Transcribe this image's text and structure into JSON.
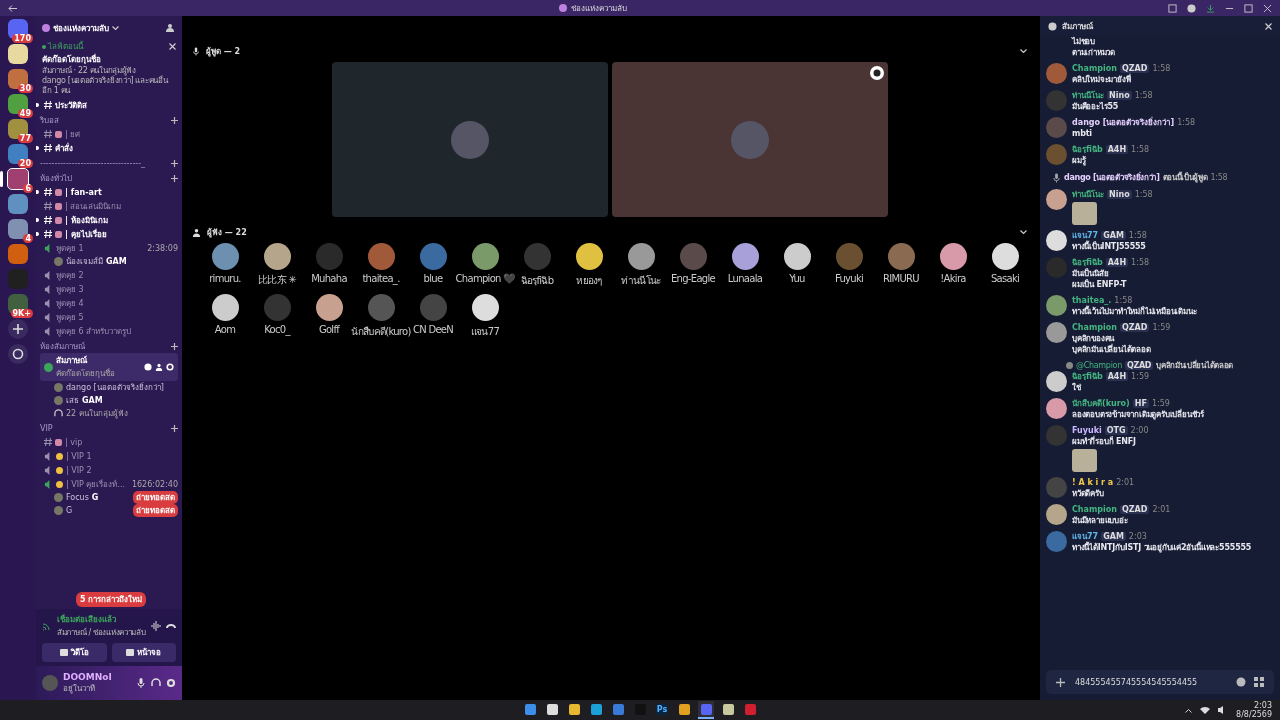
{
  "title_bar": {
    "title": "ช่องแห่งความลับ"
  },
  "servers": [
    {
      "badge": "170",
      "selected": false
    },
    {
      "selected": false
    },
    {
      "badge": "30",
      "selected": false
    },
    {
      "badge": "49",
      "selected": false
    },
    {
      "badge": "77",
      "selected": false
    },
    {
      "badge": "20",
      "selected": false
    },
    {
      "badge": "6",
      "selected": true
    },
    {
      "selected": false
    },
    {
      "badge": "4",
      "selected": false
    },
    {
      "selected": false
    },
    {
      "selected": false
    },
    {
      "badge": "9K+",
      "selected": false
    }
  ],
  "sidebar": {
    "server_name": "ช่องแห่งความลับ",
    "event": {
      "status": "ไลฟ์ตอนนี้",
      "title": "คัดก๊อดโดยกุนชื่อ",
      "meta": "สัมภาษณ์ · 22 คนในกลุ่มผู้ฟัง",
      "note": "dango [นอตอตัวจริงยิ่งกว่า] และคนอื่นอีก 1 คน"
    },
    "channels": [
      {
        "kind": "text",
        "name": "ประวัติดิส",
        "unread": true,
        "emoji": false
      },
      {
        "kind": "category",
        "name": "ริบอส"
      },
      {
        "kind": "text",
        "name": "| ยศ",
        "unread": false,
        "emoji": true
      },
      {
        "kind": "text",
        "name": "คำสั่ง",
        "unread": true,
        "emoji": false
      },
      {
        "kind": "category",
        "name": "-----------------------------------_"
      },
      {
        "kind": "category",
        "name": "ห้องทั่วไป"
      },
      {
        "kind": "text",
        "name": "| fan-art",
        "unread": true,
        "emoji": true
      },
      {
        "kind": "text",
        "name": "| สอนเล่นมินิเกม",
        "unread": false,
        "emoji": true
      },
      {
        "kind": "text",
        "name": "| ห้องมินิเกม",
        "unread": true,
        "emoji": true
      },
      {
        "kind": "text",
        "name": "| คุยไปเรื่อย",
        "unread": true,
        "emoji": true
      },
      {
        "kind": "voice",
        "name": "พูดคุย 1",
        "active": true,
        "time": "2:38:09",
        "emoji": false
      },
      {
        "kind": "user",
        "name": "น้องเจมส์มี",
        "tag": "GAM"
      },
      {
        "kind": "voice",
        "name": "พูดคุย 2",
        "active": false,
        "emoji": false
      },
      {
        "kind": "voice",
        "name": "พูดคุย 3",
        "active": false,
        "emoji": false
      },
      {
        "kind": "voice",
        "name": "พูดคุย 4",
        "active": false,
        "emoji": false
      },
      {
        "kind": "voice",
        "name": "พูดคุย 5",
        "active": false,
        "emoji": false
      },
      {
        "kind": "voice",
        "name": "พูดคุย 6 สำหรับวาดรูป",
        "active": false,
        "emoji": false
      },
      {
        "kind": "category",
        "name": "ห้องสัมภาษณ์"
      },
      {
        "kind": "stage",
        "name": "สัมภาษณ์",
        "sub": "คัดก๊อดโดยกุนชื่อ",
        "selected": true
      },
      {
        "kind": "user",
        "name": "dango [นอตอตัวจริงยิ่งกว่า]"
      },
      {
        "kind": "user",
        "name": "เสธ",
        "tag": "GAM"
      },
      {
        "kind": "listeners",
        "name": "22 คนในกลุ่มผู้ฟัง"
      },
      {
        "kind": "category",
        "name": "VIP"
      },
      {
        "kind": "text",
        "name": "| vip",
        "unread": false,
        "emoji": true
      },
      {
        "kind": "voice",
        "name": "| VIP 1",
        "active": false,
        "emoji": true
      },
      {
        "kind": "voice",
        "name": "| VIP 2",
        "active": false,
        "emoji": true
      },
      {
        "kind": "voice",
        "name": "| VIP คุยเรื่องท์...",
        "active": true,
        "time": "1626:02:40",
        "emoji": true
      },
      {
        "kind": "user",
        "name": "Focus",
        "tag": "G",
        "live": "ถ่ายทอดสด"
      },
      {
        "kind": "user",
        "name": "G",
        "live": "ถ่ายทอดสด"
      }
    ],
    "mentions": "5 การกล่าวถึงใหม่"
  },
  "voice_panel": {
    "status": "เชื่อมต่อเสียงแล้ว",
    "location": "สัมภาษณ์ / ช่องแห่งความลับ",
    "buttons": [
      "วิดีโอ",
      "หน้าจอ"
    ]
  },
  "user_panel": {
    "name": "DOOMNoI",
    "status": "อยู่ในวาที"
  },
  "stage": {
    "speakers_heading": "ผู้พูด — 2",
    "speakers": [
      {
        "color": "#1f272c",
        "moderator": false
      },
      {
        "color": "#4b3434",
        "moderator": true
      }
    ],
    "listeners_heading": "ผู้ฟัง — 22",
    "listeners": [
      "rimuru.",
      "比比东 ✳",
      "Muhaha",
      "thaitea_.",
      "blue",
      "Champion 🖤",
      "ฉิอรฺfiฉิb",
      "หยองๆ",
      "ท่านนีโนะ",
      "Eng-Eagle",
      "Lunaala",
      "Yuu",
      "Fuyuki",
      "RIMURU",
      "!Akira",
      "Sasaki",
      "Aom",
      "Koc0_",
      "Golff",
      "นักสืบคดี(kuro)",
      "CN DeeN",
      "แจน77"
    ]
  },
  "chat": {
    "title": "สัมภาษณ์",
    "messages": [
      {
        "kind": "continuation",
        "lines": [
          "ไม่ชอบ",
          "ตามเก่าหมวด"
        ]
      },
      {
        "kind": "message",
        "author": "Champion",
        "color": "#43b581",
        "tag": "QZAD",
        "time": "1:58",
        "lines": [
          "คลิปใหม่จะมายังพี่"
        ]
      },
      {
        "kind": "message",
        "author": "ท่านนีโนะ",
        "color": "#43b581",
        "tag": "Nino",
        "time": "1:58",
        "lines": [
          "มันคืออะไร55"
        ]
      },
      {
        "kind": "message",
        "author": "dango [นอตอตัวจริงยิ่งกว่า]",
        "color": "#e6d0ff",
        "time": "1:58",
        "lines": [
          "mbti"
        ]
      },
      {
        "kind": "message",
        "author": "ฉิอรฺfiฉิb",
        "color": "#43b581",
        "tag": "A4H",
        "time": "1:58",
        "lines": [
          "ผมรู้"
        ]
      },
      {
        "kind": "system",
        "author": "dango [นอตอตัวจริงยิ่งกว่า]",
        "text": "ตอนนี้เป็นผู้พูด",
        "time": "1:58"
      },
      {
        "kind": "message",
        "author": "ท่านนีโนะ",
        "color": "#43b581",
        "tag": "Nino",
        "time": "1:58",
        "image": true
      },
      {
        "kind": "message",
        "author": "แจน77",
        "color": "#5fb4e8",
        "tag": "GAM",
        "time": "1:58",
        "lines": [
          "ทางนี้เป็นINTJ55555"
        ]
      },
      {
        "kind": "message",
        "author": "ฉิอรฺfiฉิb",
        "color": "#43b581",
        "tag": "A4H",
        "time": "1:58",
        "lines": [
          "มันเป็นนิสัย",
          "ผมเป็น ENFP-T"
        ]
      },
      {
        "kind": "message",
        "author": "thaitea_.",
        "color": "#43b581",
        "time": "1:58",
        "lines": [
          "ทางนี้เว้นไปมาทำใหม่ก็ไม่เหมือนเดิมนะ"
        ]
      },
      {
        "kind": "message",
        "author": "Champion",
        "color": "#43b581",
        "tag": "QZAD",
        "time": "1:59",
        "lines": [
          "บุคลิกของคน",
          "บุคลิกมันเปลี่ยนได้ตลอด"
        ]
      },
      {
        "kind": "message",
        "author": "ฉิอรฺfiฉิb",
        "color": "#43b581",
        "tag": "A4H",
        "time": "1:59",
        "lines": [
          "ใช่"
        ],
        "reply": {
          "author": "@Champion",
          "tag": "QZAD",
          "text": "บุคลิกมันเปลี่ยนได้ตลอด"
        }
      },
      {
        "kind": "message",
        "author": "นักสืบคดี(kuro)",
        "color": "#43b581",
        "tag": "HF",
        "time": "1:59",
        "lines": [
          "ลองตอบตรงข้ามจากเดิมดูครับเปลี่ยนชัวร์"
        ]
      },
      {
        "kind": "message",
        "author": "Fuyuki",
        "color": "#c8b6ff",
        "tag": "OTG",
        "time": "2:00",
        "lines": [
          "ผมทำกี่รอบก็ ENFJ"
        ],
        "image": true
      },
      {
        "kind": "message",
        "author": "! A k i r a",
        "color": "#f0c94a",
        "time": "2:01",
        "lines": [
          "หวัดดีครับ"
        ]
      },
      {
        "kind": "message",
        "author": "Champion",
        "color": "#43b581",
        "tag": "QZAD",
        "time": "2:01",
        "lines": [
          "มันมีหลายแบบอ่ะ"
        ]
      },
      {
        "kind": "message",
        "author": "แจน77",
        "color": "#5fb4e8",
        "tag": "GAM",
        "time": "2:03",
        "lines": [
          "ทางนี้ได้INTJกับISTJ วนอยู่กับแค่2อันนี้แหละ555555"
        ]
      }
    ],
    "input": {
      "value": "484555455745554545554455"
    }
  },
  "taskbar": {
    "apps": [
      {
        "kind": "start",
        "active": false
      },
      {
        "kind": "search",
        "active": false
      },
      {
        "kind": "files",
        "active": false
      },
      {
        "kind": "browser",
        "active": false
      },
      {
        "kind": "store",
        "active": false
      },
      {
        "kind": "tiktok",
        "active": false
      },
      {
        "kind": "photoshop",
        "label": "Ps",
        "active": false
      },
      {
        "kind": "chrome",
        "active": false
      },
      {
        "kind": "discord",
        "active": true
      },
      {
        "kind": "app",
        "active": false
      },
      {
        "kind": "app2",
        "active": false
      }
    ],
    "time": "2:03",
    "date": "8/8/2569"
  }
}
